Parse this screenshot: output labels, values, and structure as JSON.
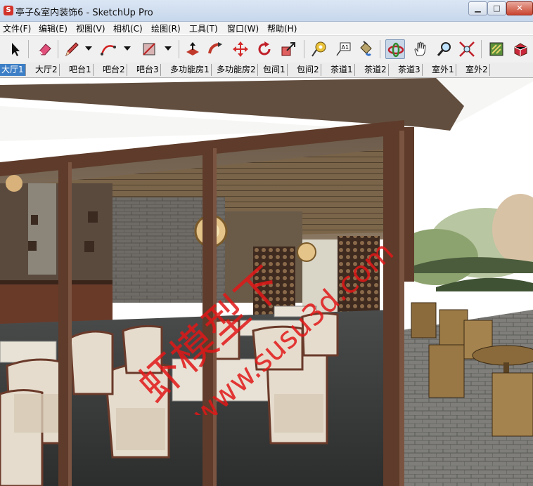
{
  "window": {
    "title": "亭子&室内装饰6 - SketchUp Pro",
    "app_icon_glyph": "S",
    "minimize_glyph": "▁",
    "maximize_glyph": "□",
    "close_glyph": "✕"
  },
  "menu": {
    "items": [
      "文件(F)",
      "编辑(E)",
      "视图(V)",
      "相机(C)",
      "绘图(R)",
      "工具(T)",
      "窗口(W)",
      "帮助(H)"
    ]
  },
  "toolbar": {
    "tools": [
      {
        "icon": "select-arrow-icon"
      },
      {
        "icon": "eraser-icon"
      },
      {
        "icon": "pencil-line-icon"
      },
      {
        "icon": "arc-icon"
      },
      {
        "icon": "rectangle-icon"
      },
      {
        "icon": "push-pull-icon"
      },
      {
        "icon": "follow-me-icon"
      },
      {
        "icon": "move-icon"
      },
      {
        "icon": "rotate-icon"
      },
      {
        "icon": "scale-icon"
      },
      {
        "icon": "tape-measure-icon"
      },
      {
        "icon": "text-label-icon"
      },
      {
        "icon": "paint-bucket-icon"
      },
      {
        "icon": "orbit-icon"
      },
      {
        "icon": "pan-hand-icon"
      },
      {
        "icon": "zoom-icon"
      },
      {
        "icon": "zoom-extents-icon"
      },
      {
        "icon": "component-icon"
      },
      {
        "icon": "ruby-extension-icon"
      }
    ],
    "text_tool_glyph": "A1",
    "active_tool": "orbit",
    "colors": {
      "eraser": "#e0507a",
      "arc": "#d22020",
      "push": "#c0392b",
      "move": "#d42a2a",
      "rotate": "#c0202a"
    }
  },
  "scenes": {
    "active": "大厅1",
    "tabs": [
      "大厅1",
      "大厅2",
      "吧台1",
      "吧台2",
      "吧台3",
      "多功能房1",
      "多功能房2",
      "包间1",
      "包间2",
      "茶道1",
      "茶道2",
      "茶道3",
      "室外1",
      "室外2"
    ]
  },
  "watermark": {
    "line1": "虾模型下",
    "line2": "www.susu3d.com",
    "color": "#e01818"
  }
}
